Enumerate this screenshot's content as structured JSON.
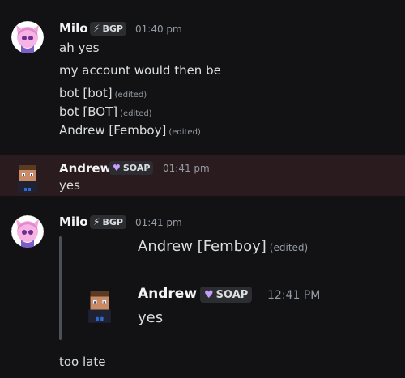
{
  "messages": [
    {
      "author": "Milo",
      "tag": "BGP",
      "tag_icon": "lightning-icon",
      "time": "01:40 pm",
      "lines": [
        {
          "text": "ah yes",
          "edited": ""
        },
        {
          "text": "my account would then be",
          "edited": ""
        },
        {
          "text": "bot [bot]",
          "edited": "(edited)"
        },
        {
          "text": "bot [BOT]",
          "edited": "(edited)"
        },
        {
          "text": "Andrew [Femboy]",
          "edited": "(edited)"
        }
      ]
    },
    {
      "author": "Andrew",
      "tag": "SOAP",
      "tag_icon": "heart-icon",
      "time": "01:41 pm",
      "lines": [
        {
          "text": "yes"
        }
      ]
    },
    {
      "author": "Milo",
      "tag": "BGP",
      "tag_icon": "lightning-icon",
      "time": "01:41 pm",
      "quote": {
        "top_text": "Andrew [Femboy]",
        "top_edited": "(edited)",
        "author": "Andrew",
        "tag": "SOAP",
        "time": "12:41 PM",
        "text": "yes"
      },
      "after": "too late"
    }
  ],
  "colors": {
    "background": "#121214",
    "highlight": "#2a1c1e",
    "soap_heart": "#c89bff",
    "tag_bg": "#2b2d31"
  }
}
